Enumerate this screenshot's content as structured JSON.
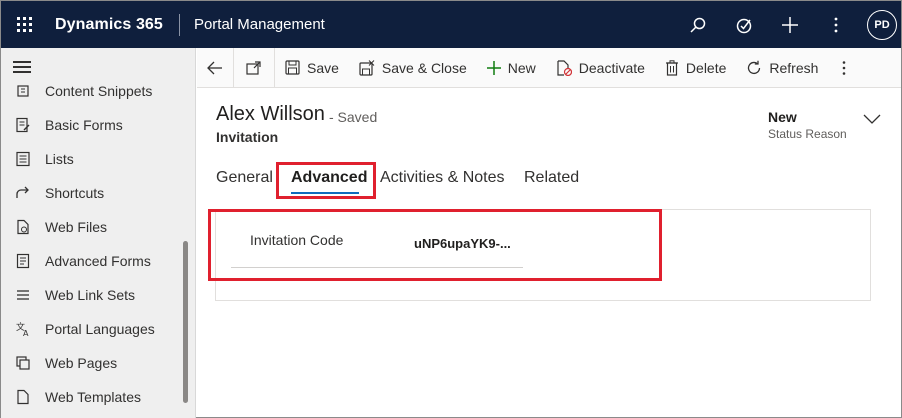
{
  "topbar": {
    "app_name": "Dynamics 365",
    "area_name": "Portal Management",
    "icons": [
      "search-icon",
      "task-icon",
      "plus-icon",
      "more-icon"
    ],
    "avatar_initials": "PD"
  },
  "sidebar": {
    "items": [
      {
        "label": "Content Snippets",
        "icon": "snippet-icon"
      },
      {
        "label": "Basic Forms",
        "icon": "form-icon"
      },
      {
        "label": "Lists",
        "icon": "list-icon"
      },
      {
        "label": "Shortcuts",
        "icon": "shortcut-icon"
      },
      {
        "label": "Web Files",
        "icon": "file-icon"
      },
      {
        "label": "Advanced Forms",
        "icon": "advanced-form-icon"
      },
      {
        "label": "Web Link Sets",
        "icon": "link-set-icon"
      },
      {
        "label": "Portal Languages",
        "icon": "language-icon"
      },
      {
        "label": "Web Pages",
        "icon": "pages-icon"
      },
      {
        "label": "Web Templates",
        "icon": "template-icon"
      }
    ]
  },
  "commandbar": {
    "save": "Save",
    "save_close": "Save & Close",
    "new": "New",
    "deactivate": "Deactivate",
    "delete": "Delete",
    "refresh": "Refresh"
  },
  "record": {
    "name": "Alex Willson",
    "saved_status": "- Saved",
    "entity": "Invitation",
    "status_value": "New",
    "status_label": "Status Reason"
  },
  "tabs": [
    {
      "label": "General",
      "active": false
    },
    {
      "label": "Advanced",
      "active": true
    },
    {
      "label": "Activities & Notes",
      "active": false
    },
    {
      "label": "Related",
      "active": false
    }
  ],
  "fields": {
    "invitation_code_label": "Invitation Code",
    "invitation_code_value": "uNP6upaYK9-..."
  },
  "colors": {
    "topbar": "#0f1f3d",
    "highlight": "#e0202e",
    "accent": "#0f6cbd"
  }
}
